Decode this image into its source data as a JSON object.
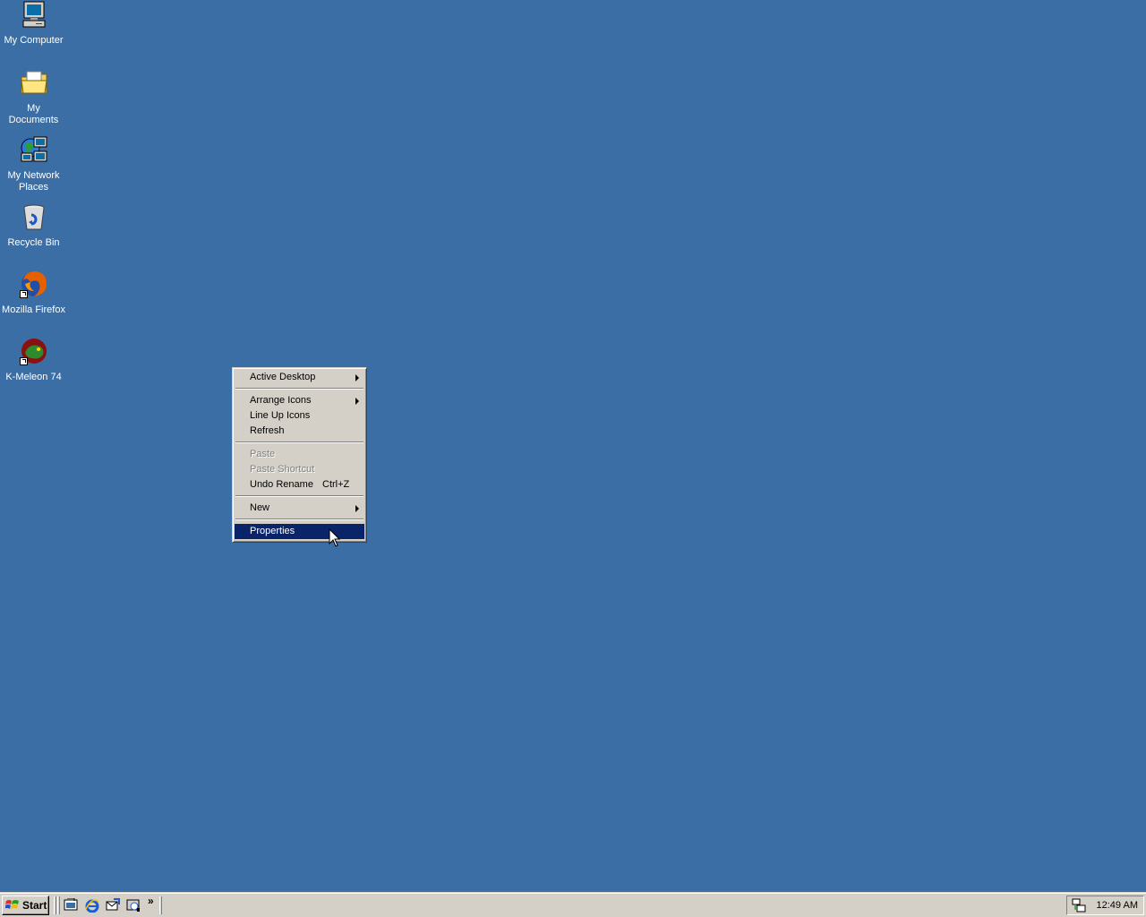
{
  "desktop": {
    "background": "#3a6ea5",
    "icons": [
      {
        "label": "My Computer",
        "icon": "computer-icon"
      },
      {
        "label": "My Documents",
        "icon": "folder-icon"
      },
      {
        "label": "My Network Places",
        "icon": "network-icon"
      },
      {
        "label": "Recycle Bin",
        "icon": "recycle-bin-icon"
      },
      {
        "label": "Mozilla Firefox",
        "icon": "firefox-icon",
        "shortcut": true
      },
      {
        "label": "K-Meleon 74",
        "icon": "kmeleon-icon",
        "shortcut": true
      }
    ]
  },
  "context_menu": {
    "items": [
      {
        "label": "Active Desktop",
        "submenu": true
      },
      {
        "label": "Arrange Icons",
        "submenu": true
      },
      {
        "label": "Line Up Icons"
      },
      {
        "label": "Refresh"
      },
      {
        "label": "Paste",
        "disabled": true
      },
      {
        "label": "Paste Shortcut",
        "disabled": true
      },
      {
        "label": "Undo Rename",
        "shortcut": "Ctrl+Z"
      },
      {
        "label": "New",
        "submenu": true
      },
      {
        "label": "Properties",
        "selected": true
      }
    ],
    "selected_color": "#0a246a"
  },
  "taskbar": {
    "start_label": "Start",
    "quick_launch": [
      "show-desktop-icon",
      "internet-explorer-icon",
      "outlook-express-icon",
      "media-icon"
    ],
    "chevron": "»",
    "clock": "12:49 AM"
  }
}
